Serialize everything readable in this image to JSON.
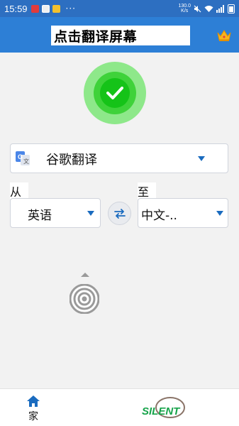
{
  "status_bar": {
    "time": "15:59",
    "net_speed_value": "130.0",
    "net_speed_unit": "K/s",
    "more_glyph": "···"
  },
  "app_bar": {
    "title": "点击翻译屏幕"
  },
  "translator": {
    "engine": "谷歌翻译",
    "from_label": "从",
    "to_label": "至",
    "source_language": "英语",
    "target_language": "中文-.."
  },
  "bottom_nav": {
    "home_label": "家",
    "logo_text": "SILENT"
  },
  "colors": {
    "status_bar": "#2d6fc1",
    "app_bar": "#2d7fd6",
    "accent": "#1a6bbf",
    "success": "#15c318"
  },
  "icons": [
    "check-icon",
    "crown-icon",
    "google-translate-icon",
    "swap-icon",
    "home-icon",
    "target-icon"
  ]
}
